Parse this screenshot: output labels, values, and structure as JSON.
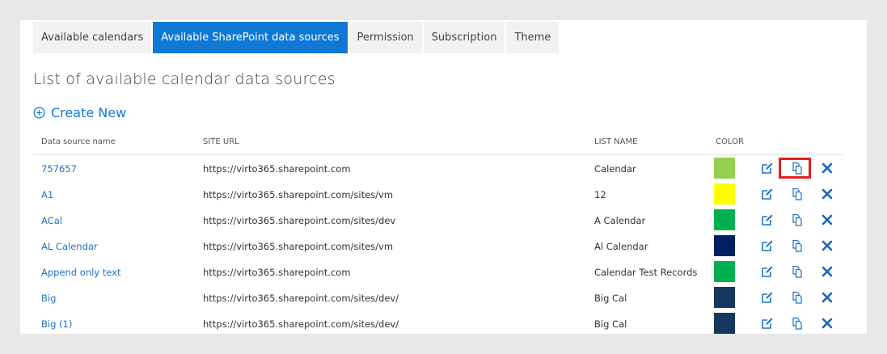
{
  "tabs": [
    {
      "label": "Available calendars",
      "active": false
    },
    {
      "label": "Available SharePoint data sources",
      "active": true
    },
    {
      "label": "Permission",
      "active": false
    },
    {
      "label": "Subscription",
      "active": false
    },
    {
      "label": "Theme",
      "active": false
    }
  ],
  "page_title": "List of available calendar data sources",
  "create_new_label": "Create New",
  "table": {
    "headers": {
      "name": "Data source name",
      "url": "SITE URL",
      "list": "LIST NAME",
      "color": "COLOR"
    },
    "rows": [
      {
        "name": "757657",
        "url": "https://virto365.sharepoint.com",
        "list": "Calendar",
        "color": "#92d050"
      },
      {
        "name": "A1",
        "url": "https://virto365.sharepoint.com/sites/vm",
        "list": "12",
        "color": "#ffff00"
      },
      {
        "name": "ACal",
        "url": "https://virto365.sharepoint.com/sites/dev",
        "list": "A Calendar",
        "color": "#00b050"
      },
      {
        "name": "AL Calendar",
        "url": "https://virto365.sharepoint.com/sites/vm",
        "list": "Al Calendar",
        "color": "#002060"
      },
      {
        "name": "Append only text",
        "url": "https://virto365.sharepoint.com",
        "list": "Calendar Test Records",
        "color": "#00b050"
      },
      {
        "name": "Big",
        "url": "https://virto365.sharepoint.com/sites/dev/",
        "list": "Big Cal",
        "color": "#17375e"
      },
      {
        "name": "Big (1)",
        "url": "https://virto365.sharepoint.com/sites/dev/",
        "list": "Big Cal",
        "color": "#17375e"
      }
    ]
  },
  "icons": {
    "create": "plus-circle-icon",
    "edit": "edit-icon",
    "copy": "copy-icon",
    "delete": "delete-icon"
  },
  "colors": {
    "accent": "#0f78d4",
    "link": "#1f72c6",
    "highlight": "#e02020"
  }
}
